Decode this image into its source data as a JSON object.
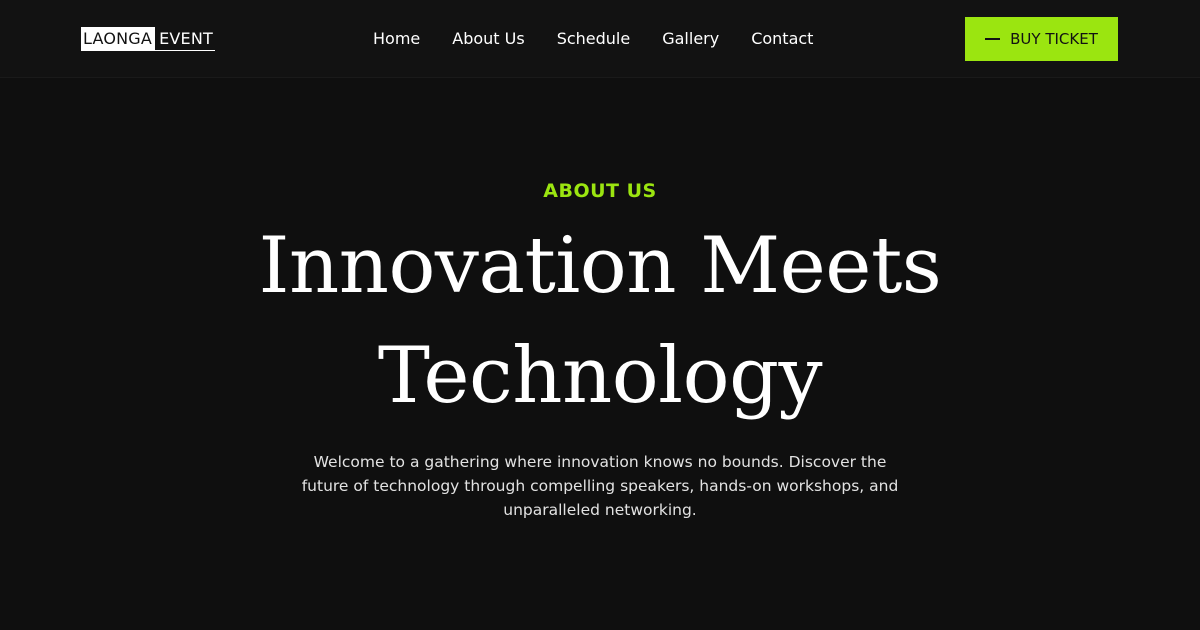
{
  "header": {
    "logo": {
      "part_a": "LAONGA",
      "part_b": "EVENT"
    },
    "nav": [
      {
        "label": "Home"
      },
      {
        "label": "About Us"
      },
      {
        "label": "Schedule"
      },
      {
        "label": "Gallery"
      },
      {
        "label": "Contact"
      }
    ],
    "cta": {
      "label": "BUY TICKET",
      "icon": "dash-icon"
    }
  },
  "hero": {
    "eyebrow": "ABOUT US",
    "title_line_1": "Innovation Meets",
    "title_line_2": "Technology",
    "description": "Welcome to a gathering where innovation knows no bounds. Discover the future of technology through compelling speakers, hands-on workshops, and unparalleled networking."
  },
  "colors": {
    "background": "#0f0f0f",
    "header_background": "#121212",
    "accent": "#9be510",
    "text": "#ffffff"
  }
}
